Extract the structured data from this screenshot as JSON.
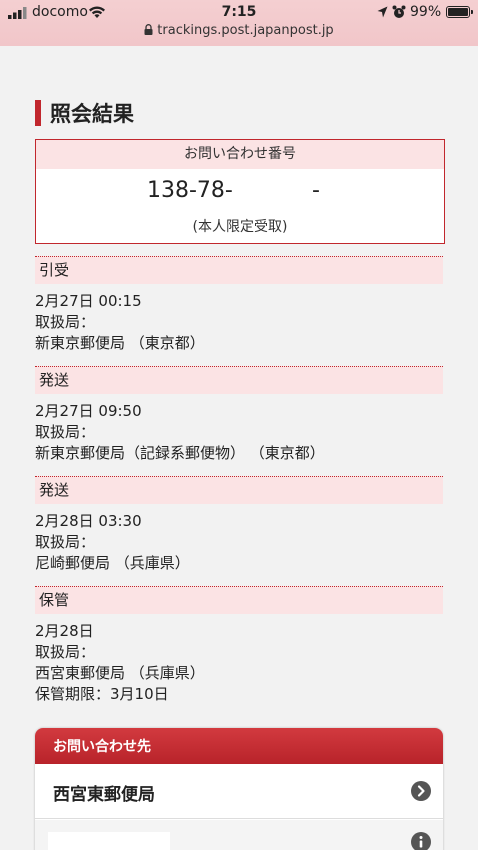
{
  "status_bar": {
    "carrier": "docomo",
    "time": "7:15",
    "battery": "99%",
    "url": "trackings.post.japanpost.jp"
  },
  "page": {
    "title": "照会結果"
  },
  "inquiry": {
    "label": "お問い合わせ番号",
    "number_part1": "138-78-",
    "number_part2": "-",
    "note": "(本人限定受取)"
  },
  "events": [
    {
      "status": "引受",
      "date": "2月27日 00:15",
      "office_label": "取扱局：",
      "office": "新東京郵便局 （東京都）"
    },
    {
      "status": "発送",
      "date": "2月27日 09:50",
      "office_label": "取扱局：",
      "office": "新東京郵便局（記録系郵便物） （東京都）"
    },
    {
      "status": "発送",
      "date": "2月28日 03:30",
      "office_label": "取扱局：",
      "office": "尼崎郵便局 （兵庫県）"
    },
    {
      "status": "保管",
      "date": "2月28日",
      "office_label": "取扱局：",
      "office": "西宮東郵便局 （兵庫県）",
      "extra": "保管期限：3月10日"
    }
  ],
  "contact": {
    "header": "お問い合わせ先",
    "office": "西宮東郵便局"
  },
  "icons": {
    "signal": "signal-icon",
    "wifi": "wifi-icon",
    "location": "location-arrow-icon",
    "alarm": "alarm-icon",
    "battery": "battery-icon",
    "lock": "lock-icon",
    "chevron": "chevron-right-circle-icon",
    "info": "info-circle-icon"
  },
  "colors": {
    "accent": "#c1272d",
    "header_pink": "#fbe3e4",
    "status_bar": "#f3cbce"
  }
}
